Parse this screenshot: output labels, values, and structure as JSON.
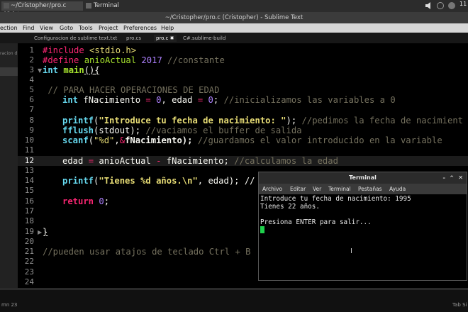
{
  "taskbar": {
    "items": [
      "~/Cristopher/pro.c (Crist…",
      "Terminal"
    ],
    "clock": "11"
  },
  "window_title": "~/Cristopher/pro.c (Cristopher) - Sublime Text",
  "menu": [
    "ection",
    "Find",
    "View",
    "Goto",
    "Tools",
    "Project",
    "Preferences",
    "Help"
  ],
  "tabs": [
    "Configuracion de sublime text.txt",
    "pro.cs",
    "pro.c",
    "C#.sublime-build"
  ],
  "sidebar_text": "racion d",
  "colors": {
    "keyword": "#f92672",
    "type": "#66d9ef",
    "function": "#a6e22e",
    "number": "#ae81ff",
    "string": "#e6db74",
    "comment": "#75715e",
    "text": "#f8f8f2",
    "cursor_green": "#1fd04c"
  },
  "line_numbers": [
    "1",
    "2",
    "3",
    "4",
    "5",
    "6",
    "7",
    "8",
    "9",
    "10",
    "11",
    "12",
    "13",
    "14",
    "15",
    "16",
    "17",
    "18",
    "19",
    "20",
    "21",
    "22",
    "23",
    "24"
  ],
  "current_line": "12",
  "code": {
    "l1_kw": "#include",
    "l1_rest": " <stdio.h>",
    "l2_kw": "#define",
    "l2_name": " anioActual",
    "l2_num": " 2017",
    "l2_com": " //constante",
    "l3_type": "int",
    "l3_fn": " main",
    "l3_rest": "(){",
    "l5": " // PARA HACER OPERACIONES DE EDAD",
    "l6_type": "int",
    "l6_a": " fNacimiento ",
    "l6_eq1": "=",
    "l6_n1": " 0",
    "l6_b": ", edad ",
    "l6_eq2": "=",
    "l6_n2": " 0",
    "l6_c": "; ",
    "l6_com": "//inicializamos las variables a 0",
    "l8_fn": "printf",
    "l8_a": "(",
    "l8_str": "\"Introduce tu fecha de nacimiento: \"",
    "l8_b": "); ",
    "l8_com": "//pedimos la fecha de nacimient",
    "l9_fn": "fflush",
    "l9_a": "(stdout); ",
    "l9_com": "//vaciamos el buffer de salida",
    "l10_fn": "scanf",
    "l10_a": "(",
    "l10_str": "\"%d\"",
    "l10_b": ",",
    "l10_amp": "&",
    "l10_c": "fNacimiento); ",
    "l10_com": "//guardamos el valor introducido en la variable",
    "l12_a": "edad ",
    "l12_eq": "=",
    "l12_b": " anioActual ",
    "l12_minus": "-",
    "l12_c": " fNacimiento; ",
    "l12_com": "//calculamos la edad",
    "l14_fn": "printf",
    "l14_a": "(",
    "l14_str": "\"Tienes %d años.\\n\"",
    "l14_b": ", edad); //",
    "l16_kw": "return",
    "l16_num": " 0",
    "l16_rest": ";",
    "l19": "}",
    "l21": "//pueden usar atajos de teclado Ctrl + B"
  },
  "terminal": {
    "title": "Terminal",
    "menu": [
      "Archivo",
      "Editar",
      "Ver",
      "Terminal",
      "Pestañas",
      "Ayuda"
    ],
    "lines": [
      "Introduce tu fecha de nacimiento: 1995",
      "Tienes 22 años.",
      "",
      "Presiona ENTER para salir..."
    ]
  },
  "status": {
    "left": "mn 23",
    "right": "Tab Si"
  }
}
